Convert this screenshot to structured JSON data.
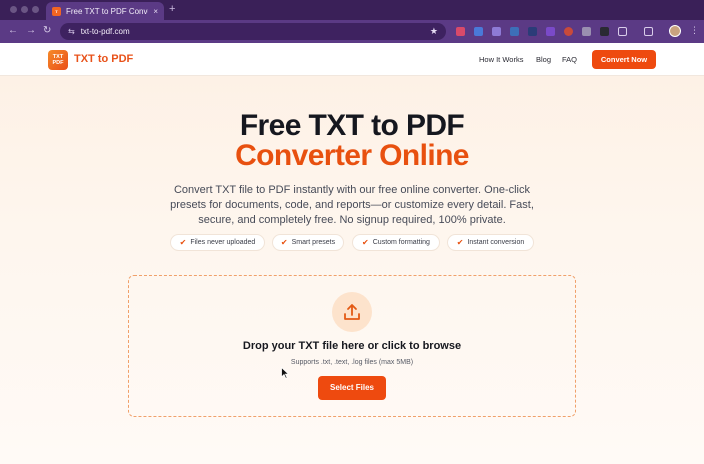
{
  "browser": {
    "tab_title": "Free TXT to PDF Converter -",
    "tab_close": "×",
    "new_tab": "+",
    "url": "txt-to-pdf.com",
    "back_icon": "←",
    "forward_icon": "→",
    "reload_icon": "↻",
    "site_info_icon": "⇆",
    "star_icon": "★",
    "menu_icon": "⋮"
  },
  "header": {
    "logo_line1": "TXT",
    "logo_line2": "PDF",
    "brand": "TXT to PDF",
    "nav": [
      "How It Works",
      "Blog",
      "FAQ"
    ],
    "cta": "Convert Now"
  },
  "hero": {
    "title_line1": "Free TXT to PDF",
    "title_line2": "Converter Online",
    "description": "Convert TXT file to PDF instantly with our free online converter. One-click presets for documents, code, and reports—or customize every detail. Fast, secure, and completely free. No signup required, 100% private.",
    "check_icon": "✔",
    "features": [
      "Files never uploaded",
      "Smart presets",
      "Custom formatting",
      "Instant conversion"
    ]
  },
  "upload": {
    "title": "Drop your TXT file here or click to browse",
    "subtitle": "Supports .txt, .text, .log files (max 5MB)",
    "button": "Select Files"
  },
  "colors": {
    "accent": "#ee4a0f",
    "browser_frame": "#5b3a85",
    "hero_bg": "#fdf0e4"
  }
}
